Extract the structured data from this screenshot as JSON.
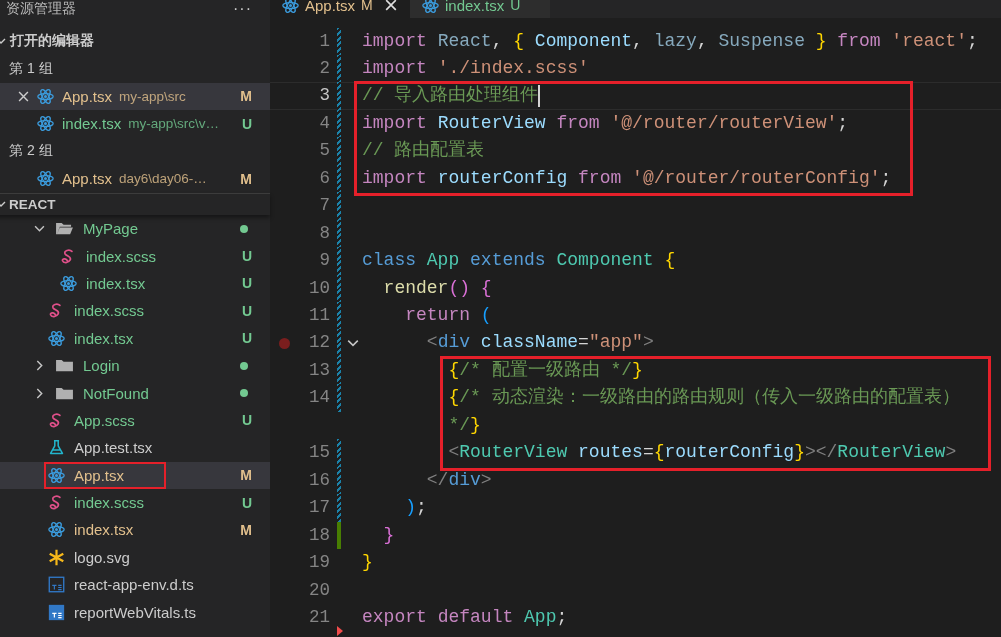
{
  "sidebar": {
    "title": "资源管理器",
    "more": "···",
    "open_editors": {
      "title": "打开的编辑器",
      "expanded": true,
      "groups": [
        {
          "title": "第 1 组",
          "files": [
            {
              "name": "App.tsx",
              "path": "my-app\\src",
              "badge": "M",
              "color": "#e2c08d",
              "kind": "react",
              "selected": true,
              "closable": true
            },
            {
              "name": "index.tsx",
              "path": "my-app\\src\\v…",
              "badge": "U",
              "color": "#73c991",
              "kind": "react",
              "selected": false,
              "closable": false
            }
          ]
        },
        {
          "title": "第 2 组",
          "files": [
            {
              "name": "App.tsx",
              "path": "day6\\day06-…",
              "badge": "M",
              "color": "#e2c08d",
              "kind": "react",
              "selected": false,
              "closable": false
            }
          ]
        }
      ]
    },
    "project": {
      "title": "REACT",
      "expanded": true
    },
    "tree": [
      {
        "name": "MyPage",
        "kind": "folder",
        "expanded": true,
        "color": "#73c991",
        "selected": false,
        "annotated": false,
        "children": [
          {
            "name": "index.scss",
            "kind": "sass",
            "color": "#73c991",
            "badge": "U",
            "selected": false,
            "annotated": false
          },
          {
            "name": "index.tsx",
            "kind": "react",
            "color": "#73c991",
            "badge": "U",
            "selected": false,
            "annotated": false
          }
        ]
      },
      {
        "name": "index.scss",
        "kind": "sass",
        "color": "#73c991",
        "badge": "U",
        "selected": false,
        "annotated": false
      },
      {
        "name": "index.tsx",
        "kind": "react",
        "color": "#73c991",
        "badge": "U",
        "selected": false,
        "annotated": false
      },
      {
        "name": "Login",
        "kind": "folder",
        "expanded": false,
        "color": "#73c991",
        "selected": false,
        "annotated": false
      },
      {
        "name": "NotFound",
        "kind": "folder",
        "expanded": false,
        "color": "#73c991",
        "selected": false,
        "annotated": false
      },
      {
        "name": "App.scss",
        "kind": "sass",
        "color": "#73c991",
        "badge": "U",
        "selected": false,
        "annotated": false
      },
      {
        "name": "App.test.tsx",
        "kind": "test",
        "color": "#cccccc",
        "selected": false,
        "annotated": false
      },
      {
        "name": "App.tsx",
        "kind": "react",
        "color": "#e2c08d",
        "badge": "M",
        "selected": true,
        "annotated": true
      },
      {
        "name": "index.scss",
        "kind": "sass",
        "color": "#73c991",
        "badge": "U",
        "selected": false,
        "annotated": false
      },
      {
        "name": "index.tsx",
        "kind": "react",
        "color": "#e2c08d",
        "badge": "M",
        "selected": false,
        "annotated": false
      },
      {
        "name": "logo.svg",
        "kind": "svg",
        "color": "#cccccc",
        "selected": false,
        "annotated": false
      },
      {
        "name": "react-app-env.d.ts",
        "kind": "ts-outline",
        "color": "#cccccc",
        "selected": false,
        "annotated": false
      },
      {
        "name": "reportWebVitals.ts",
        "kind": "ts-filled",
        "color": "#cccccc",
        "selected": false,
        "annotated": false
      }
    ]
  },
  "tabs": [
    {
      "name": "App.tsx",
      "badge": "M",
      "color": "#e2c08d",
      "selected": true,
      "closable": true
    },
    {
      "name": "index.tsx",
      "badge": "U",
      "color": "#73c991",
      "selected": false,
      "closable": false
    }
  ],
  "code": {
    "blocks": [
      {
        "annotated": false,
        "lines": [
          {
            "number": "1",
            "kind": "modified",
            "current": false,
            "breakpoint": false,
            "folding": false,
            "tokens": [
              {
                "kind": "kw",
                "text": "import "
              },
              {
                "kind": "fv",
                "text": "React"
              },
              {
                "kind": "pl",
                "text": ", "
              },
              {
                "kind": "b1",
                "text": "{ "
              },
              {
                "kind": "var",
                "text": "Component"
              },
              {
                "kind": "pl",
                "text": ", "
              },
              {
                "kind": "fv",
                "text": "lazy"
              },
              {
                "kind": "pl",
                "text": ", "
              },
              {
                "kind": "fv",
                "text": "Suspense "
              },
              {
                "kind": "b1",
                "text": "} "
              },
              {
                "kind": "kw",
                "text": "from "
              },
              {
                "kind": "str",
                "text": "'react'"
              },
              {
                "kind": "pl",
                "text": ";"
              }
            ]
          },
          {
            "number": "2",
            "kind": "modified",
            "current": false,
            "breakpoint": false,
            "folding": false,
            "tokens": [
              {
                "kind": "kw",
                "text": "import "
              },
              {
                "kind": "str",
                "text": "'./index.scss'"
              }
            ]
          }
        ]
      },
      {
        "annotated": true,
        "lines": [
          {
            "number": "3",
            "kind": "modified",
            "current": true,
            "breakpoint": false,
            "folding": false,
            "tokens": [
              {
                "kind": "com",
                "text": "// 导入路由处理组件"
              }
            ]
          },
          {
            "number": "4",
            "kind": "modified",
            "current": false,
            "breakpoint": false,
            "folding": false,
            "tokens": [
              {
                "kind": "kw",
                "text": "import "
              },
              {
                "kind": "var",
                "text": "RouterView "
              },
              {
                "kind": "kw",
                "text": "from "
              },
              {
                "kind": "str",
                "text": "'@/router/routerView'"
              },
              {
                "kind": "pl",
                "text": ";"
              }
            ]
          },
          {
            "number": "5",
            "kind": "modified",
            "current": false,
            "breakpoint": false,
            "folding": false,
            "tokens": [
              {
                "kind": "com",
                "text": "// 路由配置表"
              }
            ]
          },
          {
            "number": "6",
            "kind": "modified",
            "current": false,
            "breakpoint": false,
            "folding": false,
            "tokens": [
              {
                "kind": "kw",
                "text": "import "
              },
              {
                "kind": "var",
                "text": "routerConfig "
              },
              {
                "kind": "kw",
                "text": "from "
              },
              {
                "kind": "str",
                "text": "'@/router/routerConfig'"
              },
              {
                "kind": "pl",
                "text": ";"
              }
            ]
          }
        ]
      },
      {
        "annotated": false,
        "lines": [
          {
            "number": "7",
            "kind": "modified",
            "current": false,
            "breakpoint": false,
            "folding": false
          },
          {
            "number": "8",
            "kind": "modified",
            "current": false,
            "breakpoint": false,
            "folding": false
          },
          {
            "number": "9",
            "kind": "modified",
            "current": false,
            "breakpoint": false,
            "folding": false,
            "tokens": [
              {
                "kind": "st",
                "text": "class "
              },
              {
                "kind": "type",
                "text": "App "
              },
              {
                "kind": "st",
                "text": "extends "
              },
              {
                "kind": "type",
                "text": "Component "
              },
              {
                "kind": "b1",
                "text": "{"
              }
            ]
          },
          {
            "number": "10",
            "kind": "modified",
            "current": false,
            "breakpoint": false,
            "folding": false,
            "tokens": [
              {
                "kind": "fn",
                "text": "  render"
              },
              {
                "kind": "b2",
                "text": "() "
              },
              {
                "kind": "b2",
                "text": "{"
              }
            ]
          },
          {
            "number": "11",
            "kind": "modified",
            "current": false,
            "breakpoint": false,
            "folding": false,
            "tokens": [
              {
                "kind": "kw",
                "text": "    return "
              },
              {
                "kind": "b3",
                "text": "("
              }
            ]
          },
          {
            "number": "12",
            "kind": "modified",
            "current": false,
            "breakpoint": true,
            "folding": true,
            "tokens": [
              {
                "kind": "tp",
                "text": "      <"
              },
              {
                "kind": "st",
                "text": "div "
              },
              {
                "kind": "var",
                "text": "className"
              },
              {
                "kind": "pl",
                "text": "="
              },
              {
                "kind": "str",
                "text": "\"app\""
              },
              {
                "kind": "tp",
                "text": ">"
              }
            ]
          }
        ]
      },
      {
        "annotated": true,
        "lines": [
          {
            "number": "13",
            "kind": "modified",
            "current": false,
            "breakpoint": false,
            "folding": false,
            "tokens": [
              {
                "kind": "b1",
                "text": "        {"
              },
              {
                "kind": "com",
                "text": "/* 配置一级路由 */"
              },
              {
                "kind": "b1",
                "text": "}"
              }
            ]
          },
          {
            "number": "14",
            "kind": "modified",
            "current": false,
            "breakpoint": false,
            "folding": false,
            "tokens": [
              {
                "kind": "b1",
                "text": "        {"
              },
              {
                "kind": "com",
                "text": "/* 动态渲染：一级路由的路由规则（传入一级路由的配置表） */"
              },
              {
                "kind": "b1",
                "text": "}"
              }
            ]
          },
          {
            "number": "15",
            "kind": "modified",
            "current": false,
            "breakpoint": false,
            "folding": false,
            "tokens": [
              {
                "kind": "tp",
                "text": "        <"
              },
              {
                "kind": "type",
                "text": "RouterView "
              },
              {
                "kind": "var",
                "text": "routes"
              },
              {
                "kind": "pl",
                "text": "="
              },
              {
                "kind": "b1",
                "text": "{"
              },
              {
                "kind": "var",
                "text": "routerConfig"
              },
              {
                "kind": "b1",
                "text": "}"
              },
              {
                "kind": "tp",
                "text": "></"
              },
              {
                "kind": "type",
                "text": "RouterView"
              },
              {
                "kind": "tp",
                "text": ">"
              }
            ]
          }
        ]
      },
      {
        "annotated": false,
        "lines": [
          {
            "number": "16",
            "kind": "modified",
            "current": false,
            "breakpoint": false,
            "folding": false,
            "tokens": [
              {
                "kind": "tp",
                "text": "      </"
              },
              {
                "kind": "st",
                "text": "div"
              },
              {
                "kind": "tp",
                "text": ">"
              }
            ]
          },
          {
            "number": "17",
            "kind": "modified",
            "current": false,
            "breakpoint": false,
            "folding": false,
            "tokens": [
              {
                "kind": "b3",
                "text": "    )"
              },
              {
                "kind": "pl",
                "text": ";"
              }
            ]
          },
          {
            "number": "18",
            "kind": "added",
            "current": false,
            "breakpoint": false,
            "folding": false,
            "tokens": [
              {
                "kind": "b2",
                "text": "  }"
              }
            ]
          },
          {
            "number": "19",
            "kind": "none",
            "current": false,
            "breakpoint": false,
            "folding": false,
            "tokens": [
              {
                "kind": "b1",
                "text": "}"
              }
            ]
          },
          {
            "number": "20",
            "kind": "none",
            "current": false,
            "breakpoint": false,
            "folding": false
          },
          {
            "number": "21",
            "kind": "deleted",
            "current": false,
            "breakpoint": false,
            "folding": false,
            "tokens": [
              {
                "kind": "kw",
                "text": "export "
              },
              {
                "kind": "kw",
                "text": "default "
              },
              {
                "kind": "type",
                "text": "App"
              },
              {
                "kind": "pl",
                "text": ";"
              }
            ]
          }
        ]
      }
    ]
  }
}
